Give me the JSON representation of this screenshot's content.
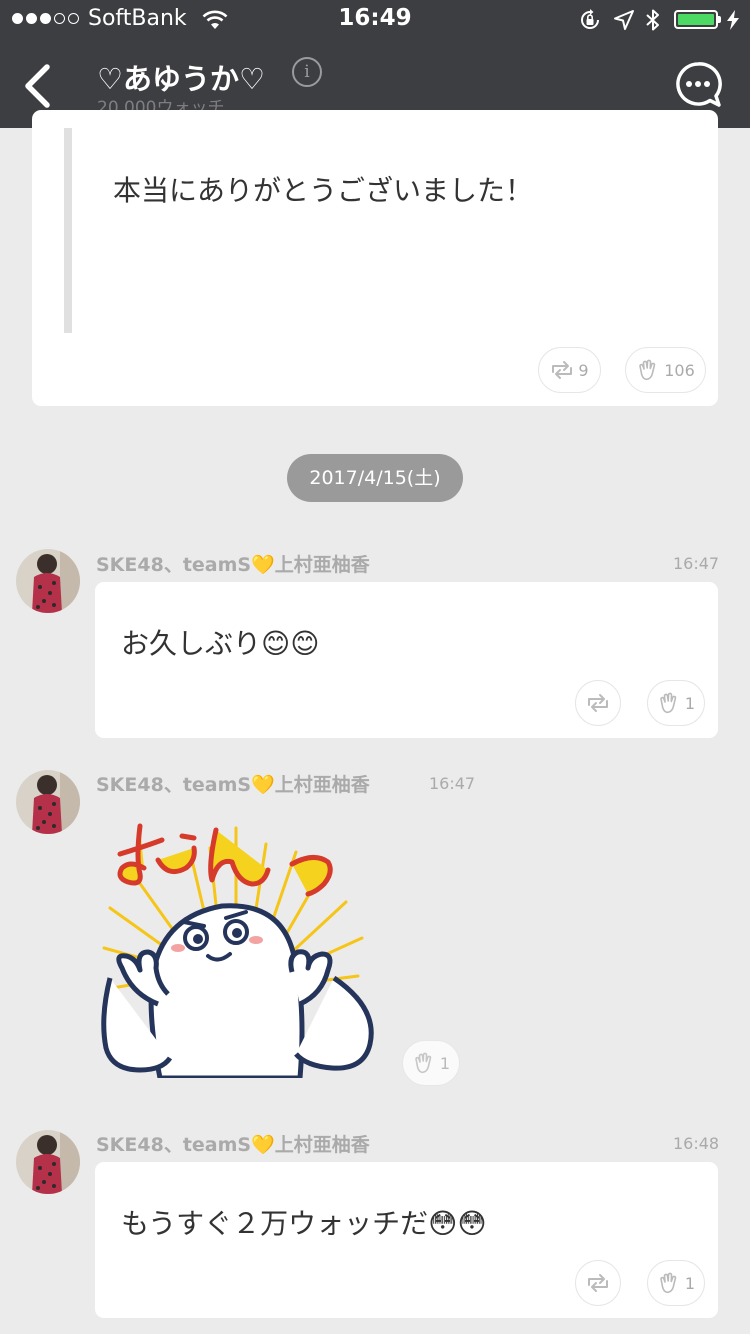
{
  "status_bar": {
    "carrier": "SoftBank",
    "time": "16:49",
    "signal_bars": 3,
    "signal_max": 5,
    "battery_level": 1.0,
    "battery_color": "#4cd964"
  },
  "header": {
    "title": "♡あゆうか♡",
    "info_glyph": "i",
    "subtitle": "20,000ウォッチ",
    "back_icon": "chevron-left-icon",
    "chat_icon": "chat-bubble-icon"
  },
  "messages": [
    {
      "text": "本当にありがとうございました！",
      "retweet_count": "9",
      "clap_count": "106"
    },
    {
      "author": "SKE48、teamS💛上村亜柚香",
      "time": "16:47",
      "text": "お久しぶり😊😊",
      "clap_count": "1"
    },
    {
      "author": "SKE48、teamS💛上村亜柚香",
      "time": "16:47",
      "sticker": "muscle-ghost-sticker",
      "sticker_text": "むんっ",
      "clap_count": "1"
    },
    {
      "author": "SKE48、teamS💛上村亜柚香",
      "time": "16:48",
      "text": "もうすぐ２万ウォッチだ😳😳",
      "clap_count": "1"
    }
  ],
  "date_divider": "2017/4/15(土)",
  "colors": {
    "header_bg": "#3d3e41",
    "background": "#ebebeb",
    "card_bg": "#ffffff",
    "date_chip_bg": "#9a9a9a"
  }
}
